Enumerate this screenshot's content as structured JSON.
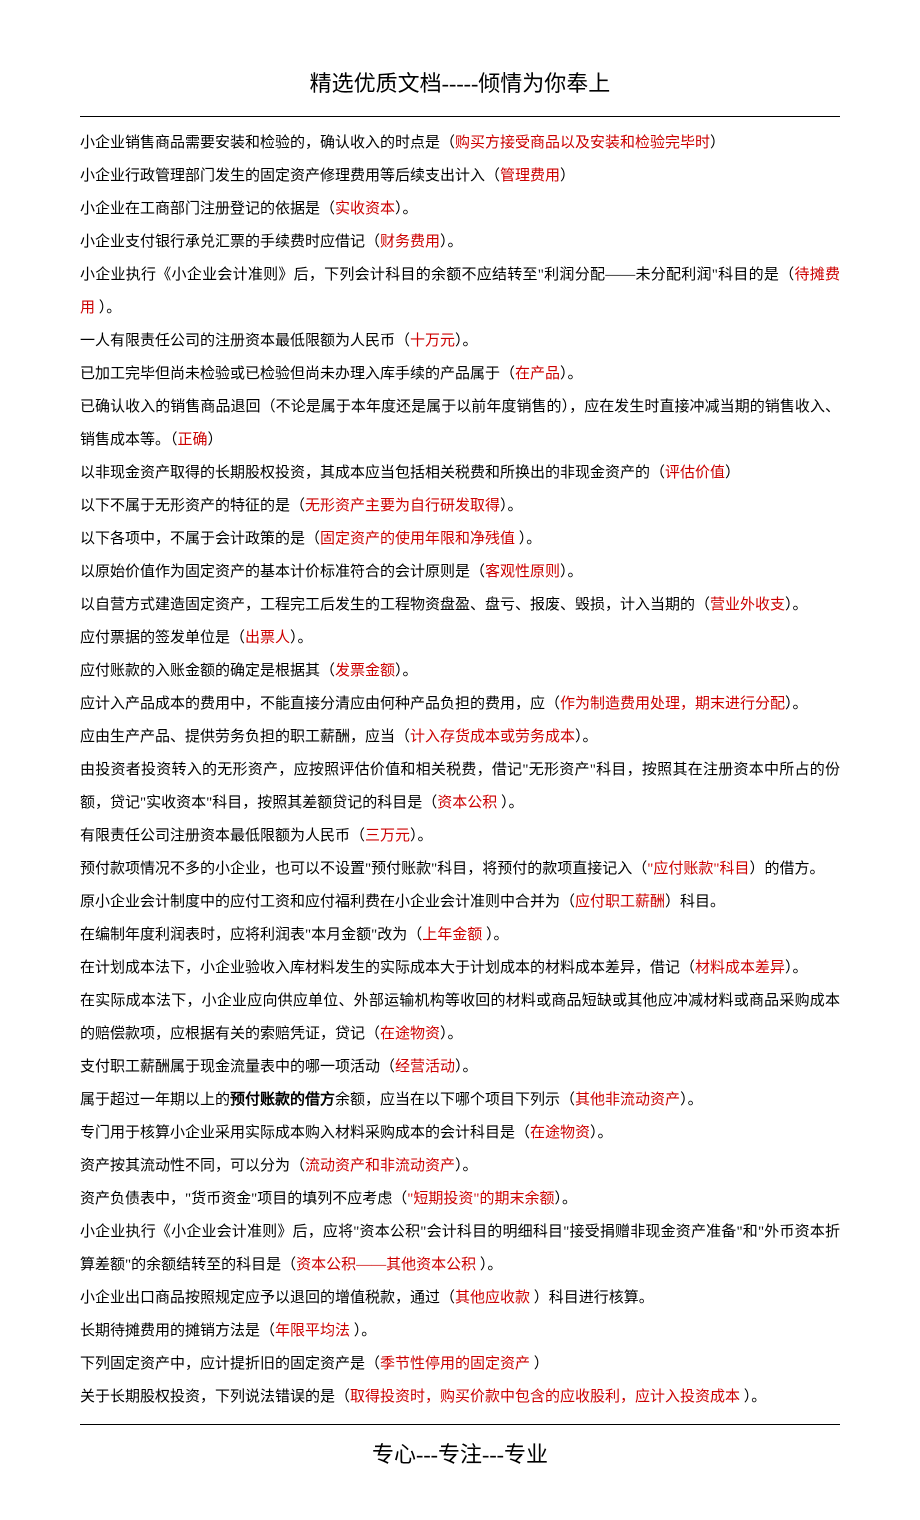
{
  "header": "精选优质文档-----倾情为你奉上",
  "footer": "专心---专注---专业",
  "lines": [
    {
      "segments": [
        {
          "t": "小企业销售商品需要安装和检验的，确认收入的时点是（"
        },
        {
          "t": "购买方接受商品以及安装和检验完毕时",
          "c": "red"
        },
        {
          "t": "）"
        }
      ]
    },
    {
      "segments": [
        {
          "t": "小企业行政管理部门发生的固定资产修理费用等后续支出计入（"
        },
        {
          "t": "管理费用",
          "c": "red"
        },
        {
          "t": "）"
        }
      ]
    },
    {
      "segments": [
        {
          "t": "小企业在工商部门注册登记的依据是（"
        },
        {
          "t": "实收资本",
          "c": "red"
        },
        {
          "t": "）。"
        }
      ]
    },
    {
      "segments": [
        {
          "t": "小企业支付银行承兑汇票的手续费时应借记（"
        },
        {
          "t": "财务费用",
          "c": "red"
        },
        {
          "t": "）。"
        }
      ]
    },
    {
      "segments": [
        {
          "t": "小企业执行《小企业会计准则》后，下列会计科目的余额不应结转至\"利润分配——未分配利润\"科目的是（"
        },
        {
          "t": "待摊费用",
          "c": "red"
        },
        {
          "t": "  ）。"
        }
      ]
    },
    {
      "segments": [
        {
          "t": "一人有限责任公司的注册资本最低限额为人民币（"
        },
        {
          "t": "十万元",
          "c": "red"
        },
        {
          "t": "）。"
        }
      ]
    },
    {
      "segments": [
        {
          "t": "已加工完毕但尚未检验或已检验但尚未办理入库手续的产品属于（"
        },
        {
          "t": "在产品",
          "c": "red"
        },
        {
          "t": "）。"
        }
      ]
    },
    {
      "segments": [
        {
          "t": "已确认收入的销售商品退回（不论是属于本年度还是属于以前年度销售的），应在发生时直接冲减当期的销售收入、销售成本等。（"
        },
        {
          "t": "正确",
          "c": "red"
        },
        {
          "t": "）"
        }
      ]
    },
    {
      "segments": [
        {
          "t": "以非现金资产取得的长期股权投资，其成本应当包括相关税费和所换出的非现金资产的（"
        },
        {
          "t": "评估价值",
          "c": "red"
        },
        {
          "t": "）"
        }
      ]
    },
    {
      "segments": [
        {
          "t": "以下不属于无形资产的特征的是（"
        },
        {
          "t": "无形资产主要为自行研发取得",
          "c": "red"
        },
        {
          "t": "）。"
        }
      ]
    },
    {
      "segments": [
        {
          "t": "以下各项中，不属于会计政策的是（"
        },
        {
          "t": "固定资产的使用年限和净残值",
          "c": "red"
        },
        {
          "t": "  ）。"
        }
      ]
    },
    {
      "segments": [
        {
          "t": "以原始价值作为固定资产的基本计价标准符合的会计原则是（"
        },
        {
          "t": "客观性原则",
          "c": "red"
        },
        {
          "t": "）。"
        }
      ]
    },
    {
      "segments": [
        {
          "t": "以自营方式建造固定资产，工程完工后发生的工程物资盘盈、盘亏、报废、毁损，计入当期的（"
        },
        {
          "t": "营业外收支",
          "c": "red"
        },
        {
          "t": "）。"
        }
      ]
    },
    {
      "segments": [
        {
          "t": "应付票据的签发单位是（"
        },
        {
          "t": "出票人",
          "c": "red"
        },
        {
          "t": "）。"
        }
      ]
    },
    {
      "segments": [
        {
          "t": "应付账款的入账金额的确定是根据其（"
        },
        {
          "t": "发票金额",
          "c": "red"
        },
        {
          "t": "）。"
        }
      ]
    },
    {
      "segments": [
        {
          "t": "应计入产品成本的费用中，不能直接分清应由何种产品负担的费用，应（"
        },
        {
          "t": "作为制造费用处理，期末进行分配",
          "c": "red"
        },
        {
          "t": "）。"
        }
      ]
    },
    {
      "segments": [
        {
          "t": "应由生产产品、提供劳务负担的职工薪酬，应当（"
        },
        {
          "t": "计入存货成本或劳务成本",
          "c": "red"
        },
        {
          "t": "）。"
        }
      ]
    },
    {
      "segments": [
        {
          "t": "由投资者投资转入的无形资产，应按照评估价值和相关税费，借记\"无形资产\"科目，按照其在注册资本中所占的份额，贷记\"实收资本\"科目，按照其差额贷记的科目是（"
        },
        {
          "t": "资本公积",
          "c": "red"
        },
        {
          "t": "  ）。"
        }
      ]
    },
    {
      "segments": [
        {
          "t": "有限责任公司注册资本最低限额为人民币（"
        },
        {
          "t": "三万元",
          "c": "red"
        },
        {
          "t": "）。"
        }
      ]
    },
    {
      "segments": [
        {
          "t": "预付款项情况不多的小企业，也可以不设置\"预付账款\"科目，将预付的款项直接记入（"
        },
        {
          "t": "\"应付账款\"科目",
          "c": "red"
        },
        {
          "t": "）的借方。"
        }
      ]
    },
    {
      "segments": [
        {
          "t": "原小企业会计制度中的应付工资和应付福利费在小企业会计准则中合并为（"
        },
        {
          "t": "应付职工薪酬",
          "c": "red"
        },
        {
          "t": "）科目。"
        }
      ]
    },
    {
      "segments": [
        {
          "t": "在编制年度利润表时，应将利润表\"本月金额\"改为（"
        },
        {
          "t": "上年金额",
          "c": "red"
        },
        {
          "t": "   ）。"
        }
      ]
    },
    {
      "segments": [
        {
          "t": "在计划成本法下，小企业验收入库材料发生的实际成本大于计划成本的材料成本差异，借记（"
        },
        {
          "t": "材料成本差异",
          "c": "red"
        },
        {
          "t": "）。"
        }
      ]
    },
    {
      "segments": [
        {
          "t": "在实际成本法下，小企业应向供应单位、外部运输机构等收回的材料或商品短缺或其他应冲减材料或商品采购成本的赔偿款项，应根据有关的索赔凭证，贷记（"
        },
        {
          "t": "在途物资",
          "c": "red"
        },
        {
          "t": "）。"
        }
      ]
    },
    {
      "segments": [
        {
          "t": "支付职工薪酬属于现金流量表中的哪一项活动（"
        },
        {
          "t": "经营活动",
          "c": "red"
        },
        {
          "t": "）。"
        }
      ]
    },
    {
      "segments": [
        {
          "t": "属于超过一年期以上的"
        },
        {
          "t": "预付账款的借方",
          "c": "bold black"
        },
        {
          "t": "余额，应当在以下哪个项目下列示（"
        },
        {
          "t": "其他非流动资产",
          "c": "red"
        },
        {
          "t": "）。"
        }
      ]
    },
    {
      "segments": [
        {
          "t": "专门用于核算小企业采用实际成本购入材料采购成本的会计科目是（"
        },
        {
          "t": "在途物资",
          "c": "red"
        },
        {
          "t": "）。"
        }
      ]
    },
    {
      "segments": [
        {
          "t": "资产按其流动性不同，可以分为（"
        },
        {
          "t": "流动资产和非流动资产",
          "c": "red"
        },
        {
          "t": "）。"
        }
      ]
    },
    {
      "segments": [
        {
          "t": "资产负债表中，\"货币资金\"项目的填列不应考虑（"
        },
        {
          "t": "\"短期投资\"的期末余额",
          "c": "red"
        },
        {
          "t": "）。"
        }
      ]
    },
    {
      "segments": [
        {
          "t": "小企业执行《小企业会计准则》后，应将\"资本公积\"会计科目的明细科目\"接受捐赠非现金资产准备\"和\"外币资本折算差额\"的余额结转至的科目是（"
        },
        {
          "t": "资本公积——其他资本公积",
          "c": "red"
        },
        {
          "t": "   ）。"
        }
      ]
    },
    {
      "segments": [
        {
          "t": "小企业出口商品按照规定应予以退回的增值税款，通过（"
        },
        {
          "t": "其他应收款",
          "c": "red"
        },
        {
          "t": "  ）科目进行核算。"
        }
      ]
    },
    {
      "segments": [
        {
          "t": "长期待摊费用的摊销方法是（"
        },
        {
          "t": "年限平均法",
          "c": "red"
        },
        {
          "t": "  ）。"
        }
      ]
    },
    {
      "segments": [
        {
          "t": "下列固定资产中，应计提折旧的固定资产是（"
        },
        {
          "t": "季节性停用的固定资产",
          "c": "red"
        },
        {
          "t": "  ）"
        }
      ]
    },
    {
      "segments": [
        {
          "t": "关于长期股权投资，下列说法错误的是（"
        },
        {
          "t": "取得投资时，购买价款中包含的应收股利，应计入投资成本",
          "c": "red"
        },
        {
          "t": "   ）。"
        }
      ]
    }
  ]
}
